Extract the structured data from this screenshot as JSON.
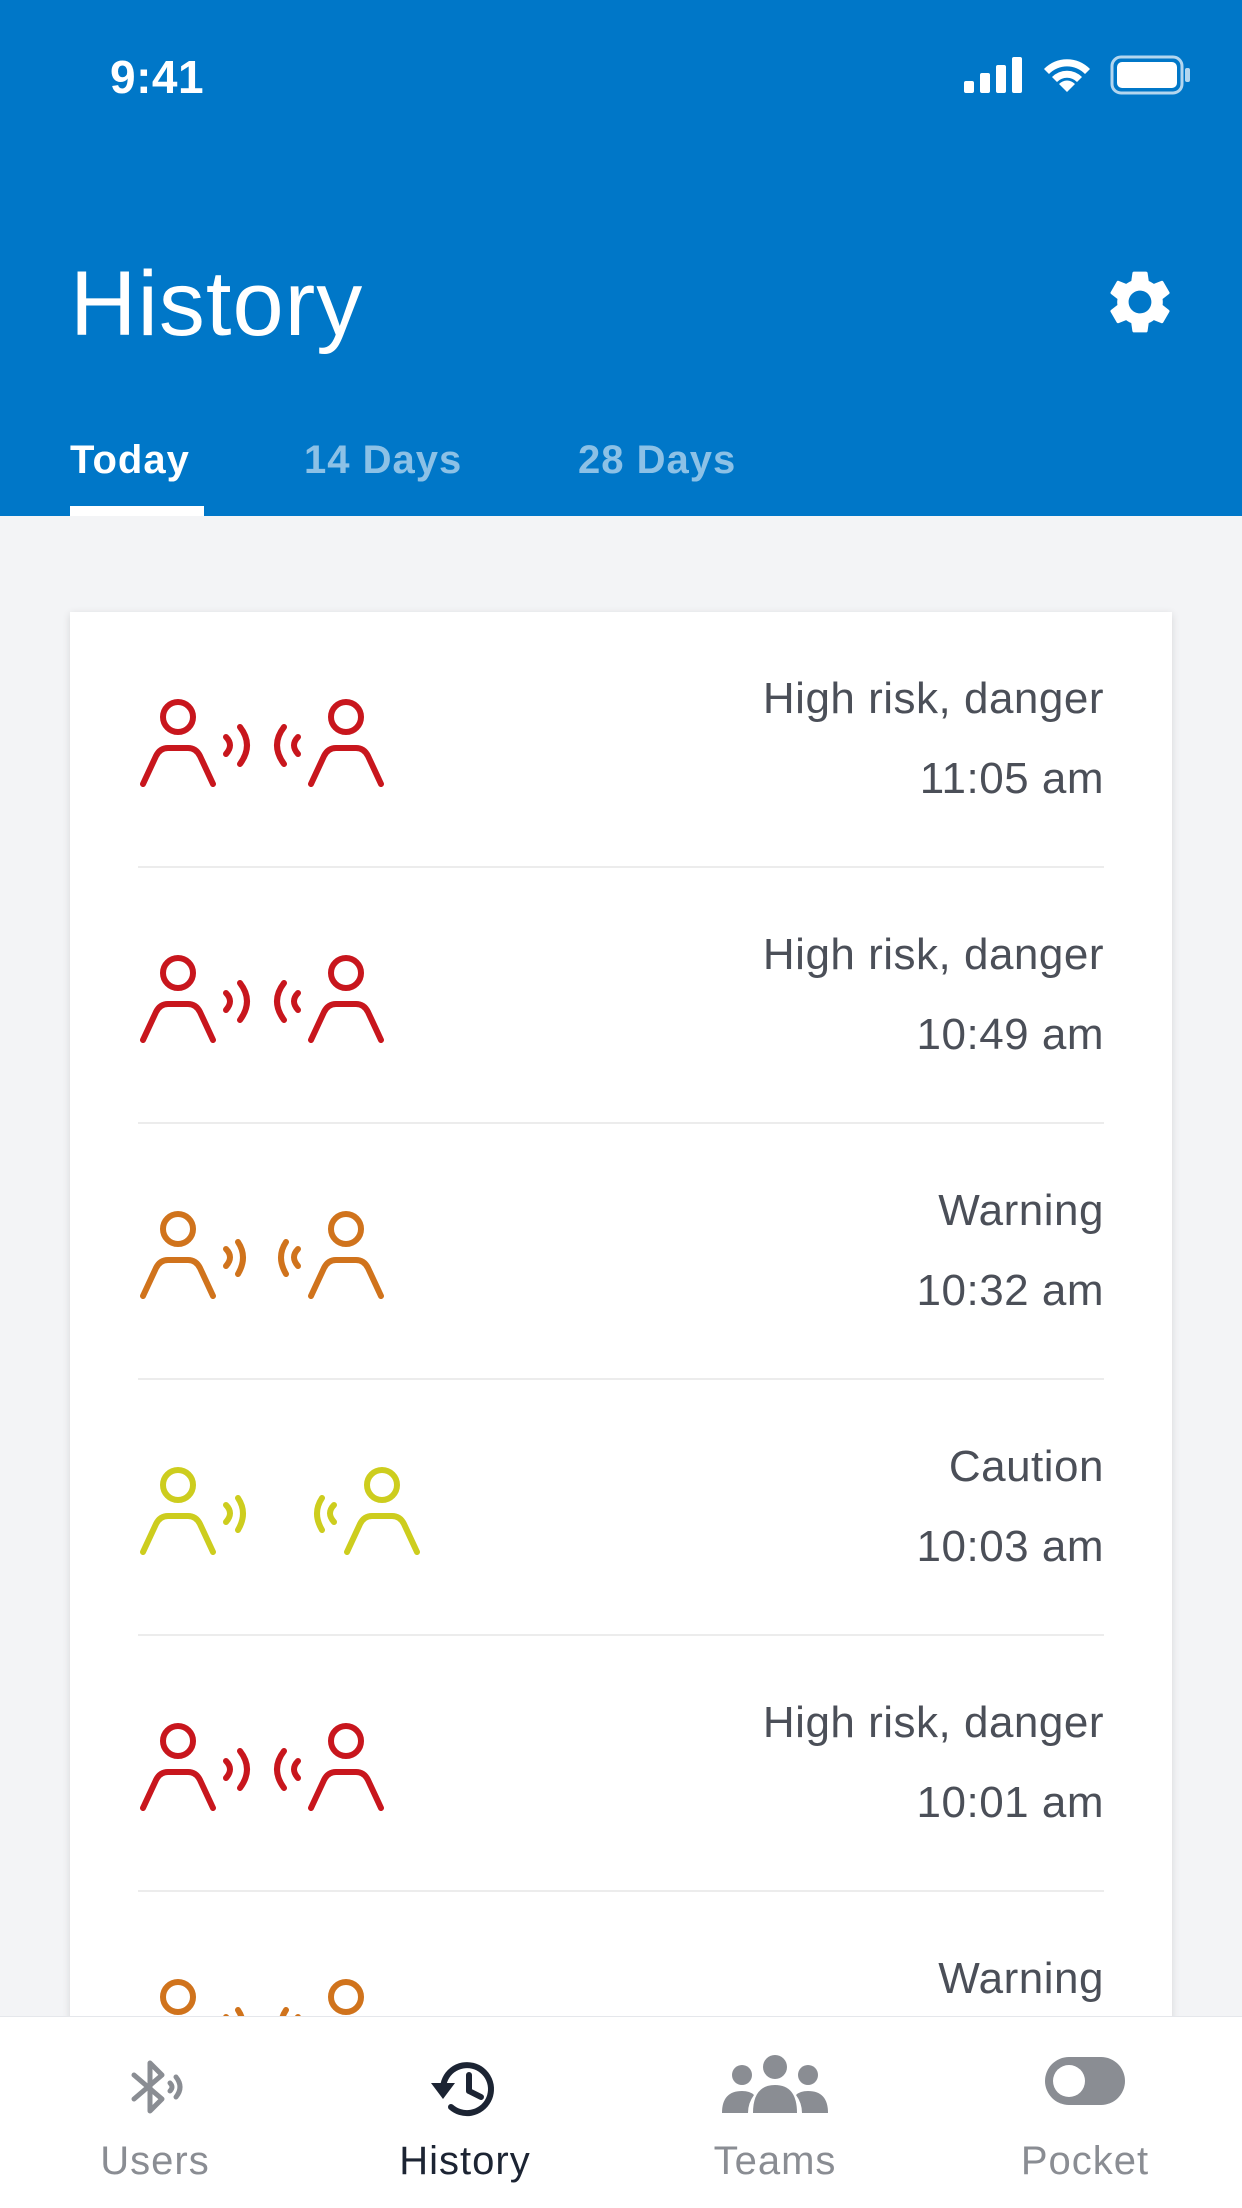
{
  "status_bar": {
    "time": "9:41"
  },
  "header": {
    "title": "History"
  },
  "tabs": [
    {
      "label": "Today",
      "active": true
    },
    {
      "label": "14 Days",
      "active": false
    },
    {
      "label": "28 Days",
      "active": false
    }
  ],
  "colors": {
    "header_bg": "#0077c8",
    "danger": "#c8161d",
    "warning": "#d0731c",
    "caution": "#cdcd1e",
    "text": "#4b4f58",
    "nav_active": "#1c2433",
    "nav_inactive": "#8a8d93"
  },
  "history": [
    {
      "status": "High risk, danger",
      "time": "11:05 am",
      "level": "danger",
      "icon": "proximity-danger-icon"
    },
    {
      "status": "High risk, danger",
      "time": "10:49 am",
      "level": "danger",
      "icon": "proximity-danger-icon"
    },
    {
      "status": "Warning",
      "time": "10:32 am",
      "level": "warning",
      "icon": "proximity-warning-icon"
    },
    {
      "status": "Caution",
      "time": "10:03 am",
      "level": "caution",
      "icon": "proximity-caution-icon"
    },
    {
      "status": "High risk, danger",
      "time": "10:01 am",
      "level": "danger",
      "icon": "proximity-danger-icon"
    },
    {
      "status": "Warning",
      "time": "",
      "level": "warning",
      "icon": "proximity-warning-icon"
    }
  ],
  "bottom_nav": [
    {
      "label": "Users",
      "icon": "bluetooth-icon",
      "active": false
    },
    {
      "label": "History",
      "icon": "history-icon",
      "active": true
    },
    {
      "label": "Teams",
      "icon": "teams-icon",
      "active": false
    },
    {
      "label": "Pocket",
      "icon": "toggle-icon",
      "active": false
    }
  ]
}
